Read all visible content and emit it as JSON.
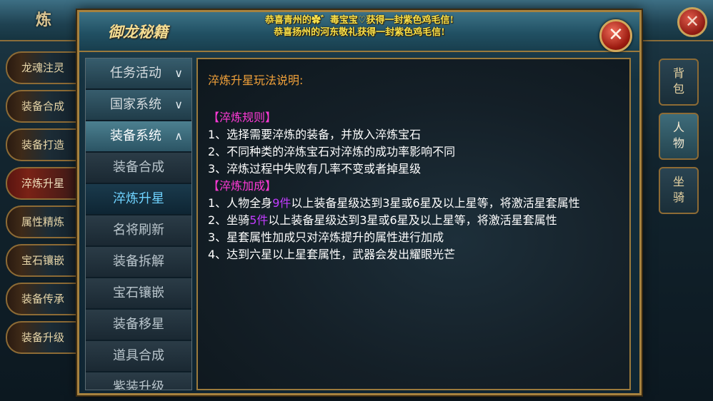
{
  "background": {
    "title": "炼 鼎",
    "left_tabs": [
      "龙魂注灵",
      "装备合成",
      "装备打造",
      "淬炼升星",
      "属性精炼",
      "宝石镶嵌",
      "装备传承",
      "装备升级"
    ],
    "active_left_tab": "淬炼升星",
    "right_tabs": [
      {
        "line1": "背",
        "line2": "包"
      },
      {
        "line1": "人",
        "line2": "物"
      },
      {
        "line1": "坐",
        "line2": "骑"
      }
    ]
  },
  "dialog": {
    "title": "御龙秘籍",
    "announcements": [
      "恭喜青州的✿゛毒宝宝♡获得一封紫色鸡毛信!",
      "恭喜扬州的河东敬礼获得一封紫色鸡毛信!"
    ],
    "close_symbol": "✕"
  },
  "menu": {
    "categories": [
      {
        "label": "任务活动",
        "chevron": "∨"
      },
      {
        "label": "国家系统",
        "chevron": "∨"
      },
      {
        "label": "装备系统",
        "chevron": "∧"
      }
    ],
    "sub_items": [
      "装备合成",
      "淬炼升星",
      "名将刷新",
      "装备拆解",
      "宝石镶嵌",
      "装备移星",
      "道具合成",
      "紫装升级"
    ],
    "selected": "淬炼升星"
  },
  "content": {
    "title": "淬炼升星玩法说明:",
    "rules_heading": "【淬炼规则】",
    "rules": [
      "1、选择需要淬炼的装备，并放入淬炼宝石",
      "2、不同种类的淬炼宝石对淬炼的成功率影响不同",
      "3、淬炼过程中失败有几率不变或者掉星级"
    ],
    "bonus_heading": "【淬炼加成】",
    "bonus_1_pre": "1、人物全身",
    "bonus_1_hl": "9件",
    "bonus_1_post": "以上装备星级达到3星或6星及以上星等，将激活星套属性",
    "bonus_2_pre": "2、坐骑",
    "bonus_2_hl": "5件",
    "bonus_2_post": "以上装备星级达到3星或6星及以上星等，将激活星套属性",
    "bonus_3": "3、星套属性加成只对淬炼提升的属性进行加成",
    "bonus_4": "4、达到六星以上星套属性，武器会发出耀眼光芒"
  },
  "colors": {
    "title_orange": "#f3a23a",
    "section_magenta": "#ff3ad7",
    "highlight_purple": "#c23cff",
    "selected_blue": "#6fd3ff",
    "announce_yellow": "#f7e04a"
  }
}
